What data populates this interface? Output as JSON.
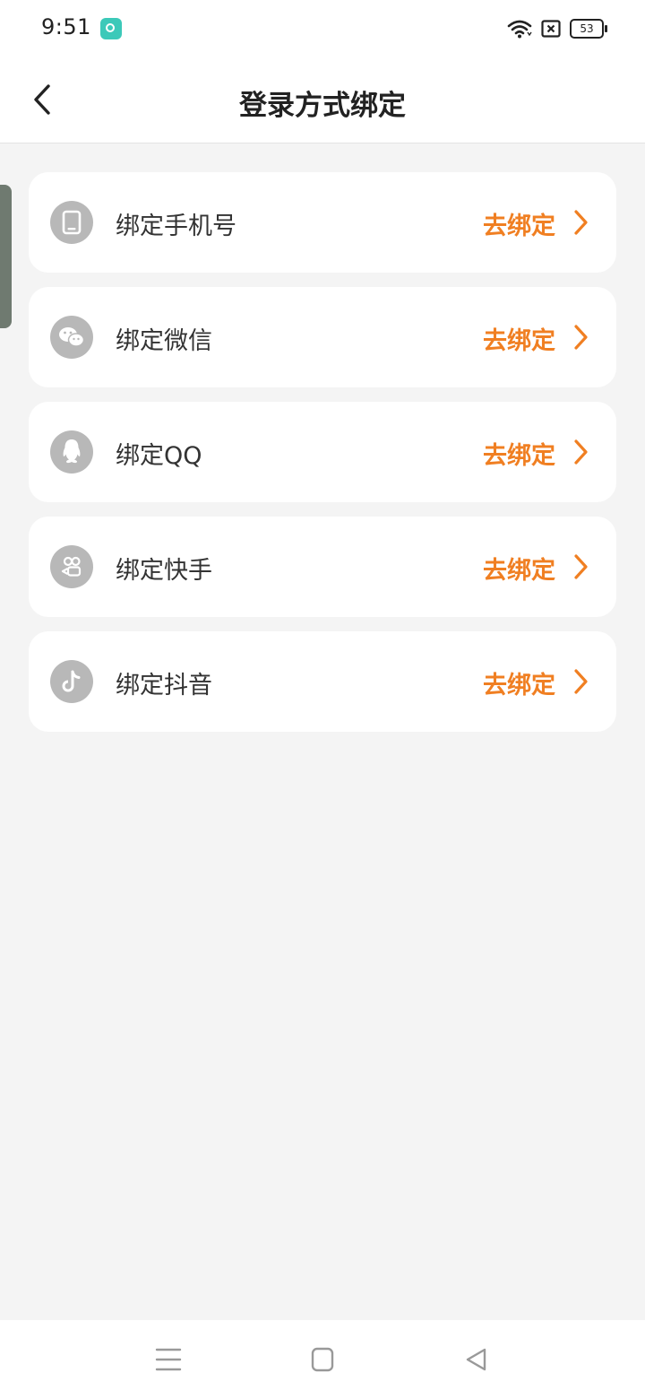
{
  "status": {
    "time": "9:51",
    "battery": "53",
    "icons": [
      "app-notification-icon",
      "wifi-icon",
      "sim-disabled-icon",
      "battery-icon"
    ]
  },
  "header": {
    "title": "登录方式绑定",
    "back_icon": "back-arrow-icon"
  },
  "bindings": [
    {
      "label": "绑定手机号",
      "action": "去绑定",
      "icon": "phone-icon"
    },
    {
      "label": "绑定微信",
      "action": "去绑定",
      "icon": "wechat-icon"
    },
    {
      "label": "绑定QQ",
      "action": "去绑定",
      "icon": "qq-icon"
    },
    {
      "label": "绑定快手",
      "action": "去绑定",
      "icon": "kuaishou-icon"
    },
    {
      "label": "绑定抖音",
      "action": "去绑定",
      "icon": "douyin-icon"
    }
  ],
  "colors": {
    "accent": "#f07f22",
    "icon_bg": "#b8b8b8",
    "page_bg": "#f4f4f4"
  },
  "nav": {
    "icons": [
      "menu-icon",
      "home-icon",
      "back-icon"
    ]
  }
}
